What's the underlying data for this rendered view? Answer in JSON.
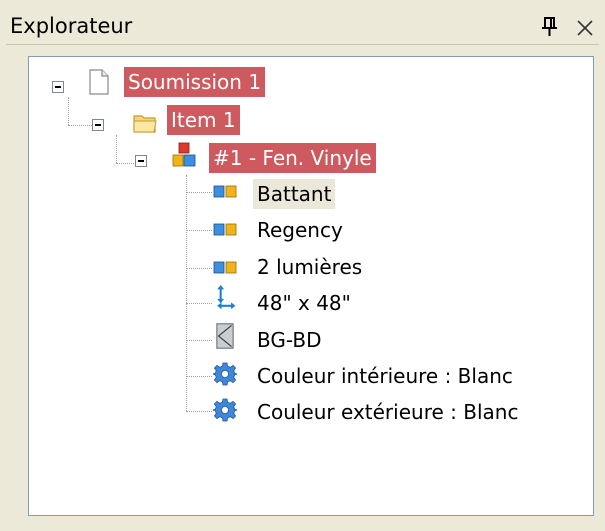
{
  "panel": {
    "title": "Explorateur",
    "pin_icon": "pin-icon",
    "close_icon": "close-icon"
  },
  "tree": {
    "root": {
      "label": "Soumission 1",
      "icon": "document-icon",
      "selected": true
    },
    "item": {
      "label": "Item 1",
      "icon": "folder-icon",
      "selected": true
    },
    "product": {
      "label": "#1 - Fen. Vinyle",
      "icon": "product-blocks-icon",
      "selected": true
    },
    "children": [
      {
        "label": "Battant",
        "icon": "window-panes-icon",
        "highlighted": true
      },
      {
        "label": "Regency",
        "icon": "window-panes-icon"
      },
      {
        "label": "2 lumières",
        "icon": "window-panes-icon"
      },
      {
        "label": "48\" x 48\"",
        "icon": "dimensions-arrows-icon"
      },
      {
        "label": "BG-BD",
        "icon": "hinge-opening-icon"
      },
      {
        "label": "Couleur intérieure : Blanc",
        "icon": "gear-icon"
      },
      {
        "label": "Couleur extérieure : Blanc",
        "icon": "gear-icon"
      }
    ]
  },
  "colors": {
    "selection": "#cc5a5f",
    "hover": "#ebe8d9",
    "panel_bg": "#ece9d8",
    "border": "#7f9db9"
  }
}
